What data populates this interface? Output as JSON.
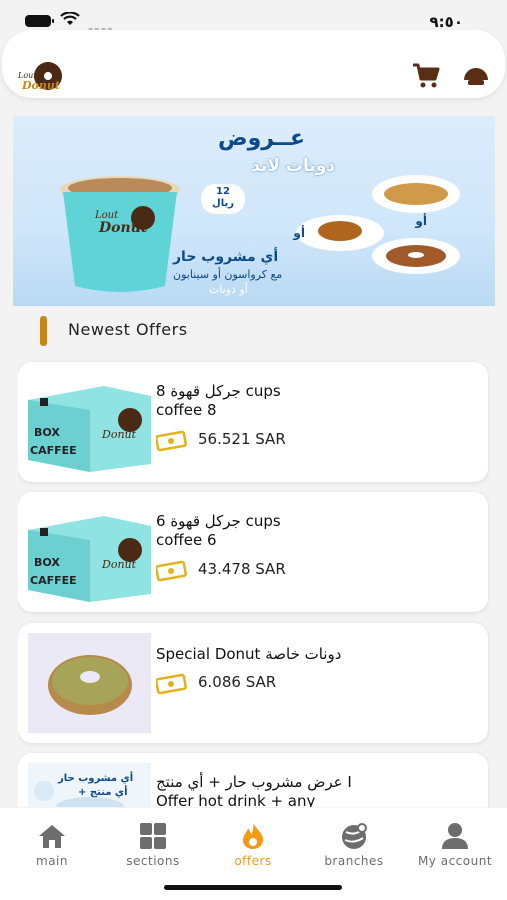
{
  "status": {
    "time": "٩:٥٠"
  },
  "header": {
    "logo_text_top": "Lout",
    "logo_text": "Donut"
  },
  "banner": {
    "title1": "عــروض",
    "title2": "دونات لاند",
    "badge_line1": "12",
    "badge_line2": "ريال",
    "or1": "أو",
    "or2": "أو",
    "text1": "أي مشروب حار",
    "text2": "مع كرواسون أو سينابون",
    "text3": "أو دونات",
    "cup_label": "Donut"
  },
  "section": {
    "title": "Newest Offers"
  },
  "items": [
    {
      "title": "جركل قهوة 8 cups\ncoffee 8",
      "price": "56.521 SAR",
      "box_text1": "BOX",
      "box_text2": "CAFFEE",
      "brand": "Donut"
    },
    {
      "title": "جركل قهوة 6 cups\ncoffee 6",
      "price": "43.478 SAR",
      "box_text1": "BOX",
      "box_text2": "CAFFEE",
      "brand": "Donut"
    },
    {
      "title": "Special Donut دونات خاصة",
      "price": "6.086 SAR"
    },
    {
      "title": "عرض مشروب حار + أي منتج I\nOffer hot drink + any",
      "thumb_text1": "أي مشروب حار",
      "thumb_text2": "+ أي منتج"
    }
  ],
  "tabs": [
    {
      "label": "main",
      "icon": "home-icon"
    },
    {
      "label": "sections",
      "icon": "grid-icon"
    },
    {
      "label": "offers",
      "icon": "flame-icon"
    },
    {
      "label": "branches",
      "icon": "branches-icon"
    },
    {
      "label": "My account",
      "icon": "user-icon"
    }
  ],
  "colors": {
    "accent": "#f29a17",
    "section_bar": "#c58a16",
    "brand_blue": "#0c4a8a",
    "box_teal": "#8fe3e3"
  }
}
